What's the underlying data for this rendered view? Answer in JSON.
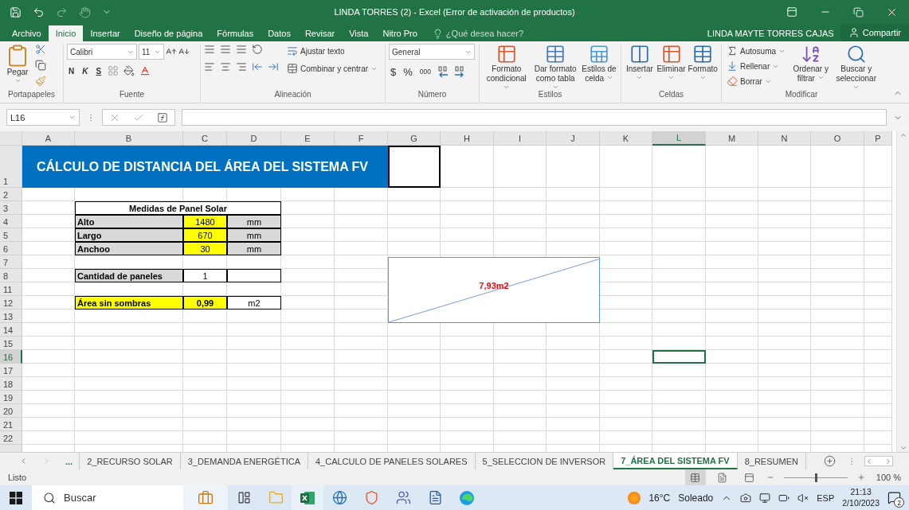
{
  "window": {
    "title": "LINDA TORRES (2) - Excel (Error de activación de productos)"
  },
  "ribbon_tabs": [
    {
      "label": "Archivo",
      "selected": false
    },
    {
      "label": "Inicio",
      "selected": true
    },
    {
      "label": "Insertar",
      "selected": false
    },
    {
      "label": "Diseño de página",
      "selected": false
    },
    {
      "label": "Fórmulas",
      "selected": false
    },
    {
      "label": "Datos",
      "selected": false
    },
    {
      "label": "Revisar",
      "selected": false
    },
    {
      "label": "Vista",
      "selected": false
    },
    {
      "label": "Nitro Pro",
      "selected": false
    }
  ],
  "tell_me": {
    "placeholder": "¿Qué desea hacer?"
  },
  "account": {
    "user": "LINDA MAYTE TORRES CAJAS",
    "share": "Compartir"
  },
  "ribbon": {
    "clipboard": {
      "label": "Portapapeles",
      "paste": "Pegar"
    },
    "font": {
      "label": "Fuente",
      "name": "Calibri",
      "size": "11",
      "bold": "N",
      "italic": "K",
      "underline": "S"
    },
    "alignment": {
      "label": "Alineación",
      "wrap": "Ajustar texto",
      "merge": "Combinar y centrar"
    },
    "number": {
      "label": "Número",
      "format": "General",
      "currency": "$",
      "percent": "%",
      "thousands": "000"
    },
    "styles": {
      "label": "Estilos",
      "buttons": [
        "Formato condicional",
        "Dar formato como tabla",
        "Estilos de celda"
      ]
    },
    "cells": {
      "label": "Celdas",
      "buttons": [
        "Insertar",
        "Eliminar",
        "Formato"
      ]
    },
    "editing": {
      "label": "Modificar",
      "autosum": "Autosuma",
      "fill": "Rellenar",
      "clear": "Borrar",
      "sort": "Ordenar y filtrar",
      "find": "Buscar y seleccionar"
    }
  },
  "formula_bar": {
    "name_box": "L16"
  },
  "sheet": {
    "columns": [
      {
        "label": "A",
        "selected": false
      },
      {
        "label": "B",
        "selected": false
      },
      {
        "label": "C",
        "selected": false
      },
      {
        "label": "D",
        "selected": false
      },
      {
        "label": "E",
        "selected": false
      },
      {
        "label": "F",
        "selected": false
      },
      {
        "label": "G",
        "selected": false
      },
      {
        "label": "H",
        "selected": false
      },
      {
        "label": "I",
        "selected": false
      },
      {
        "label": "J",
        "selected": false
      },
      {
        "label": "K",
        "selected": false
      },
      {
        "label": "L",
        "selected": true
      },
      {
        "label": "M",
        "selected": false
      },
      {
        "label": "N",
        "selected": false
      },
      {
        "label": "O",
        "selected": false
      },
      {
        "label": "P",
        "selected": false
      }
    ],
    "rows": [
      {
        "number": "1",
        "selected": false
      },
      {
        "number": "2",
        "selected": false
      },
      {
        "number": "3",
        "selected": false
      },
      {
        "number": "4",
        "selected": false
      },
      {
        "number": "5",
        "selected": false
      },
      {
        "number": "6",
        "selected": false
      },
      {
        "number": "7",
        "selected": false
      },
      {
        "number": "8",
        "selected": false
      },
      {
        "number": "11",
        "selected": false
      },
      {
        "number": "12",
        "selected": false
      },
      {
        "number": "13",
        "selected": false
      },
      {
        "number": "14",
        "selected": false
      },
      {
        "number": "15",
        "selected": false
      },
      {
        "number": "16",
        "selected": true
      },
      {
        "number": "17",
        "selected": false
      },
      {
        "number": "18",
        "selected": false
      },
      {
        "number": "19",
        "selected": false
      },
      {
        "number": "20",
        "selected": false
      },
      {
        "number": "21",
        "selected": false
      },
      {
        "number": "22",
        "selected": false
      }
    ],
    "title_banner": "CÁLCULO DE DISTANCIA DEL ÁREA DEL SISTEMA FV",
    "panel_table": {
      "title": "Medidas de Panel Solar",
      "rows": [
        {
          "label": "Alto",
          "value": "1480",
          "unit": "mm"
        },
        {
          "label": "Largo",
          "value": "670",
          "unit": "mm"
        },
        {
          "label": "Anchoo",
          "value": "30",
          "unit": "mm"
        }
      ]
    },
    "panel_count": {
      "label": "Cantidad de paneles",
      "value": "1"
    },
    "shade_free_area": {
      "label": "Área sin sombras",
      "value": "0,99",
      "unit": "m2"
    },
    "shape": {
      "label": "7,93m2"
    }
  },
  "sheet_tabs": {
    "more": "...",
    "tabs": [
      {
        "label": "2_RECURSO SOLAR",
        "selected": false
      },
      {
        "label": "3_DEMANDA ENERGÉTICA",
        "selected": false
      },
      {
        "label": "4_CALCULO DE PANELES SOLARES",
        "selected": false
      },
      {
        "label": "5_SELECCION DE INVERSOR",
        "selected": false
      },
      {
        "label": "7_ÁREA DEL SISTEMA FV",
        "selected": true
      },
      {
        "label": "8_RESUMEN",
        "selected": false
      }
    ]
  },
  "status_bar": {
    "status": "Listo",
    "zoom": "100 %",
    "zoom_slider": {
      "level": 0.5
    }
  },
  "taskbar": {
    "search": {
      "placeholder": "Buscar"
    },
    "weather": {
      "temperature": "16°C",
      "condition": "Soleado"
    },
    "language": "ESP",
    "time": "21:13",
    "date": "2/10/2023",
    "notifications": "2"
  }
}
